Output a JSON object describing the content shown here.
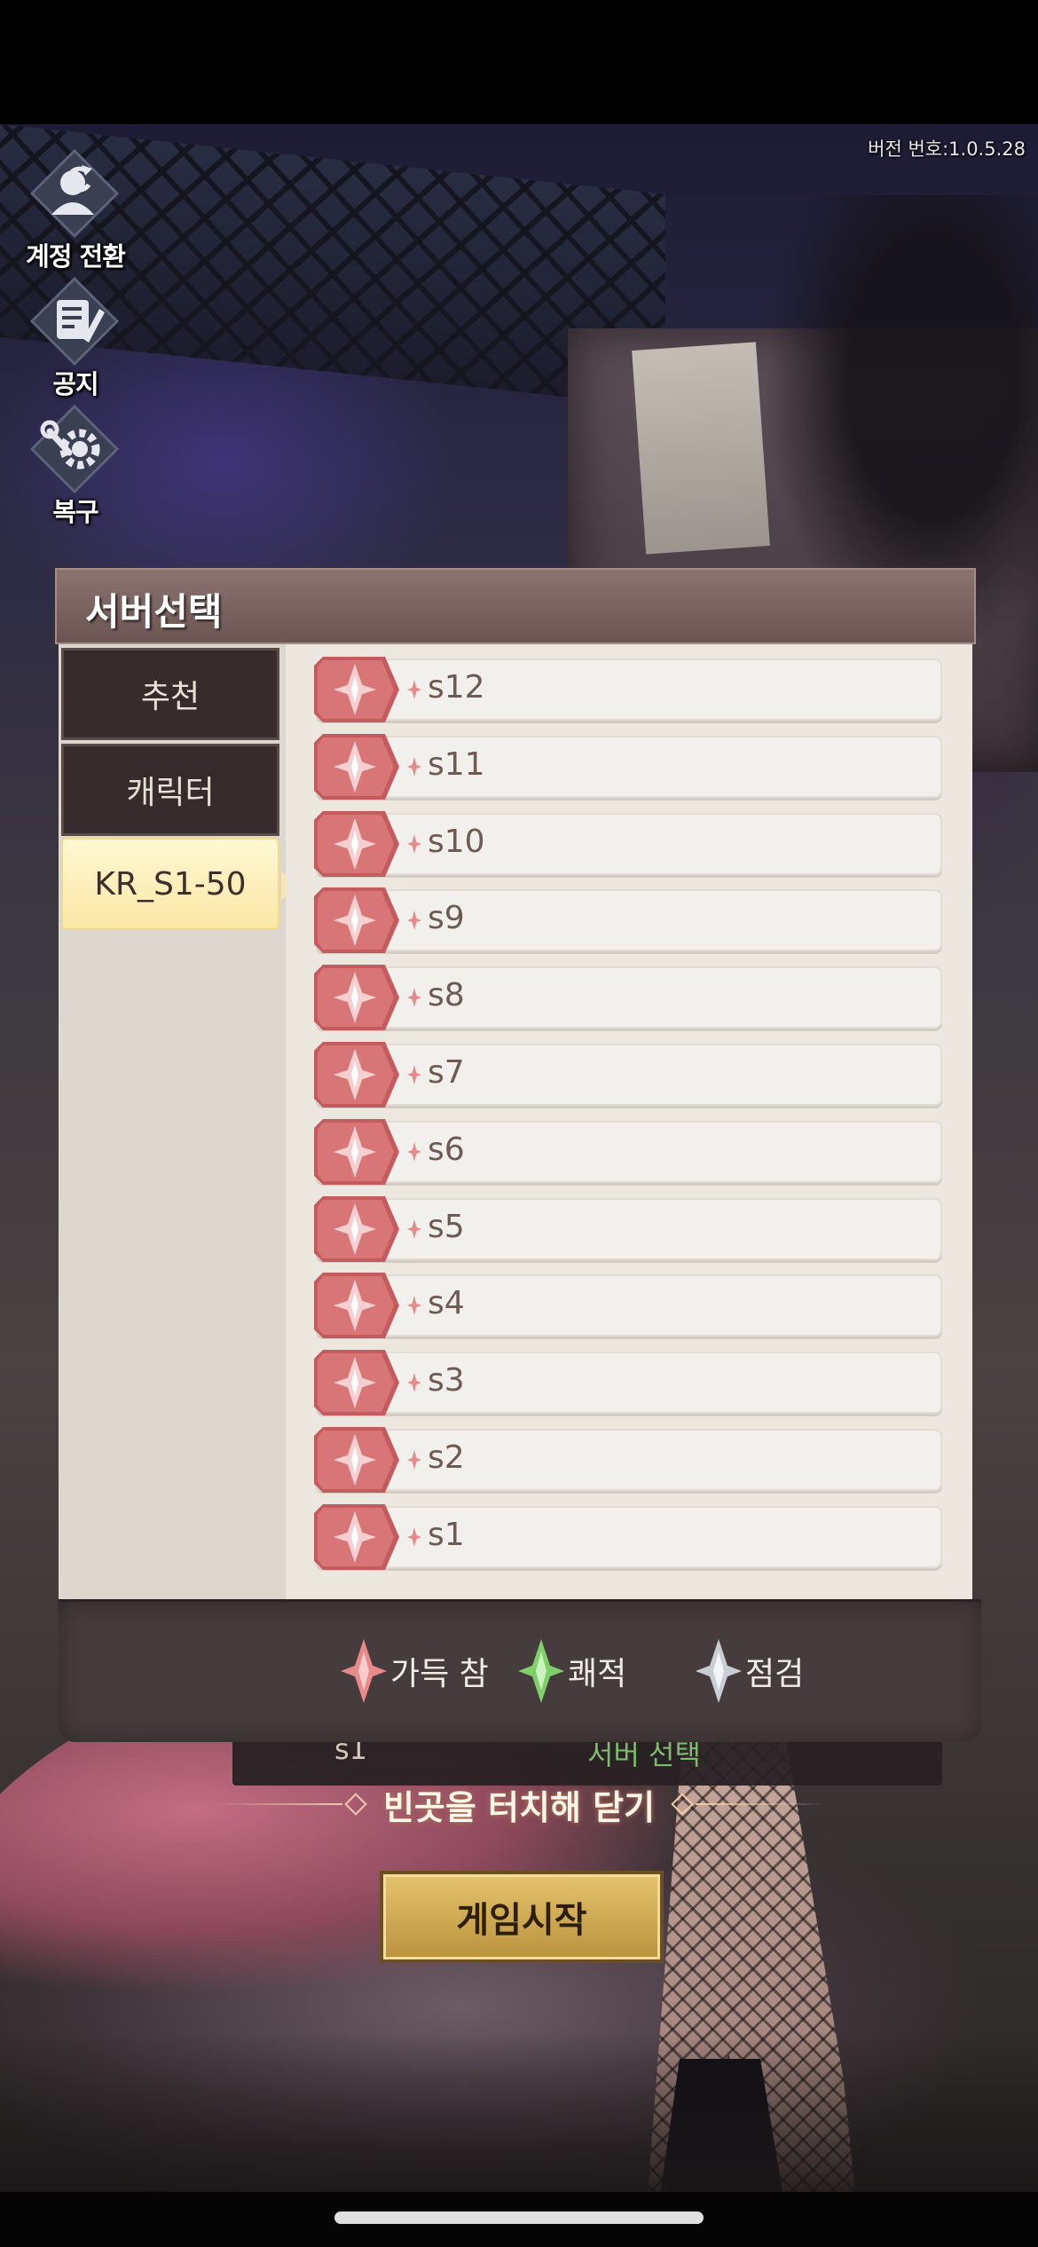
{
  "version_label": "버전 번호:1.0.5.28",
  "side_menu": {
    "switch_account": "계정 전환",
    "notice": "공지",
    "restore": "복구"
  },
  "modal": {
    "title": "서버선택",
    "tabs": [
      {
        "label": "추천",
        "active": false
      },
      {
        "label": "캐릭터",
        "active": false
      },
      {
        "label": "KR_S1-50",
        "active": true
      }
    ],
    "servers": [
      {
        "name": "s12",
        "status": "full"
      },
      {
        "name": "s11",
        "status": "full"
      },
      {
        "name": "s10",
        "status": "full"
      },
      {
        "name": "s9",
        "status": "full"
      },
      {
        "name": "s8",
        "status": "full"
      },
      {
        "name": "s7",
        "status": "full"
      },
      {
        "name": "s6",
        "status": "full"
      },
      {
        "name": "s5",
        "status": "full"
      },
      {
        "name": "s4",
        "status": "full"
      },
      {
        "name": "s3",
        "status": "full"
      },
      {
        "name": "s2",
        "status": "full"
      },
      {
        "name": "s1",
        "status": "full"
      }
    ],
    "legend": [
      {
        "label": "가득 참",
        "color": "#e98a8a",
        "status": "full"
      },
      {
        "label": "쾌적",
        "color": "#7fd06b",
        "status": "comfortable"
      },
      {
        "label": "점검",
        "color": "#c9cdd6",
        "status": "maintenance"
      }
    ]
  },
  "background_ui": {
    "current_server": "s1",
    "change_server": "서버 선택",
    "tap_to_close": "빈곳을 터치해 닫기",
    "start_button": "게임시작"
  },
  "colors": {
    "status_full": "#e98a8a",
    "status_comfortable": "#7fd06b",
    "status_maintenance": "#c9cdd6",
    "header": "#7a6361",
    "active_tab": "#fbe7a6"
  }
}
